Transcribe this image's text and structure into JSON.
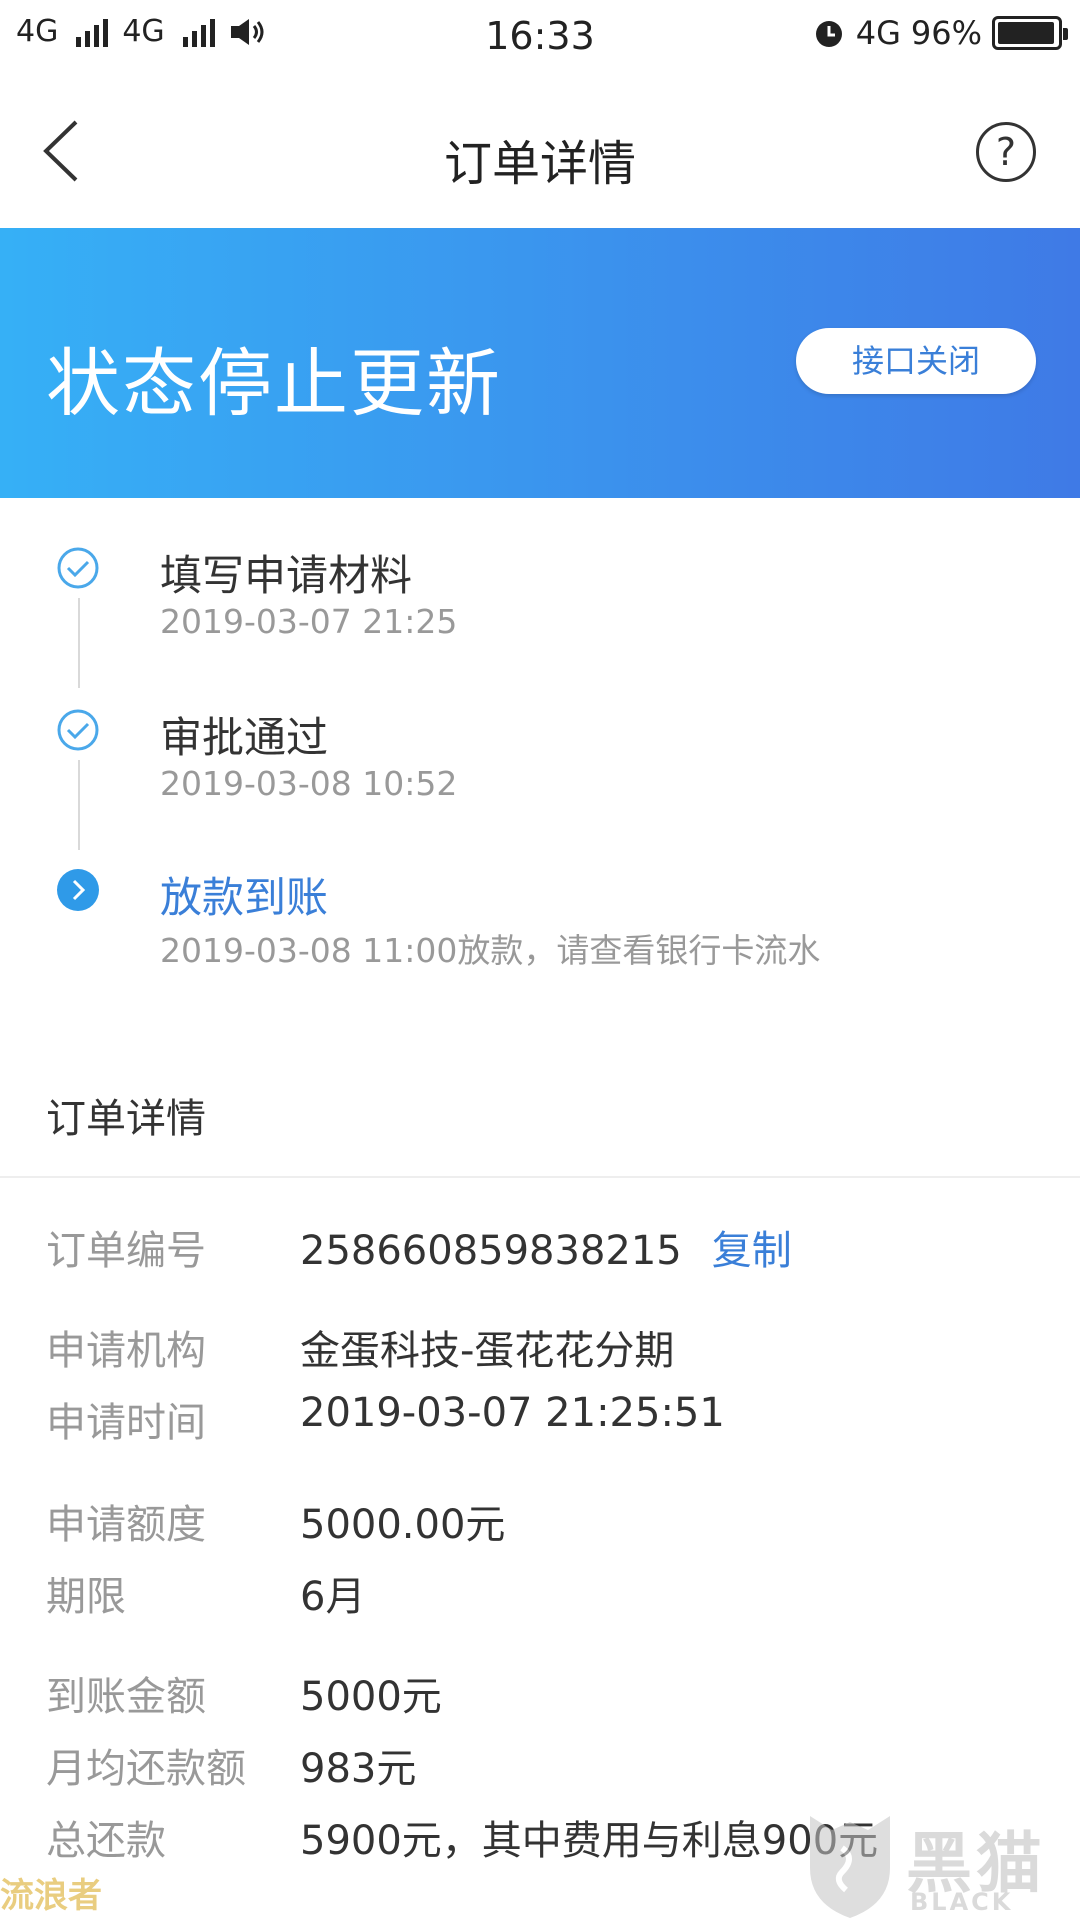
{
  "status_bar": {
    "sim1": "4G",
    "sim2": "4G",
    "time": "16:33",
    "network": "4G",
    "battery": "96%",
    "battery_level": 0.96
  },
  "nav": {
    "title": "订单详情",
    "help_glyph": "?",
    "back_icon": "chevron-left-icon"
  },
  "banner": {
    "status": "状态停止更新",
    "button": "接口关闭",
    "gradient_from": "#36b0f6",
    "gradient_to": "#3f7ae6"
  },
  "timeline": [
    {
      "title": "填写申请材料",
      "time": "2019-03-07 21:25",
      "state": "done"
    },
    {
      "title": "审批通过",
      "time": "2019-03-08 10:52",
      "state": "done"
    },
    {
      "title": "放款到账",
      "time": "2019-03-08 11:00放款，请查看银行卡流水",
      "state": "current"
    }
  ],
  "details": {
    "section_title": "订单详情",
    "order_no_label": "订单编号",
    "order_no": "258660859838215",
    "copy": "复制",
    "institution_label": "申请机构",
    "institution": "金蛋科技-蛋花花分期",
    "apply_time_label": "申请时间",
    "apply_time": "2019-03-07 21:25:51",
    "amount_label": "申请额度",
    "amount": "5000.00元",
    "term_label": "期限",
    "term": "6月",
    "received_label": "到账金额",
    "received": "5000元",
    "monthly_label": "月均还款额",
    "monthly": "983元",
    "total_label": "总还款",
    "total": "5900元，其中费用与利息900元"
  },
  "watermark": {
    "left": "流浪者",
    "brand": "黑猫",
    "brand_en": "BLACK CAT"
  },
  "colors": {
    "accent": "#3a7fd8",
    "muted": "#999999",
    "text": "#333333"
  }
}
